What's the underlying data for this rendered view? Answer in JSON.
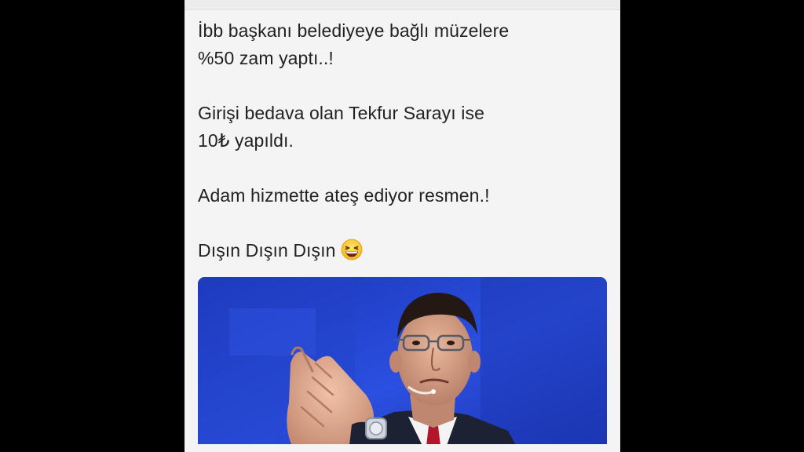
{
  "post": {
    "lines": [
      "İbb başkanı belediyeye bağlı müzelere",
      "%50 zam yaptı..!",
      "Girişi bedava olan Tekfur Sarayı ise",
      "10₺ yapıldı.",
      "Adam hizmette ateş ediyor resmen.!",
      "Dışın Dışın Dışın"
    ],
    "emoji": "grinning-squinting-face-icon"
  },
  "photo": {
    "subject": "man-in-suit-finger-gun-photo",
    "background_color": "#1f3fc9"
  },
  "colors": {
    "page_background": "#000000",
    "card_background": "#f4f4f4",
    "text": "#222222"
  }
}
